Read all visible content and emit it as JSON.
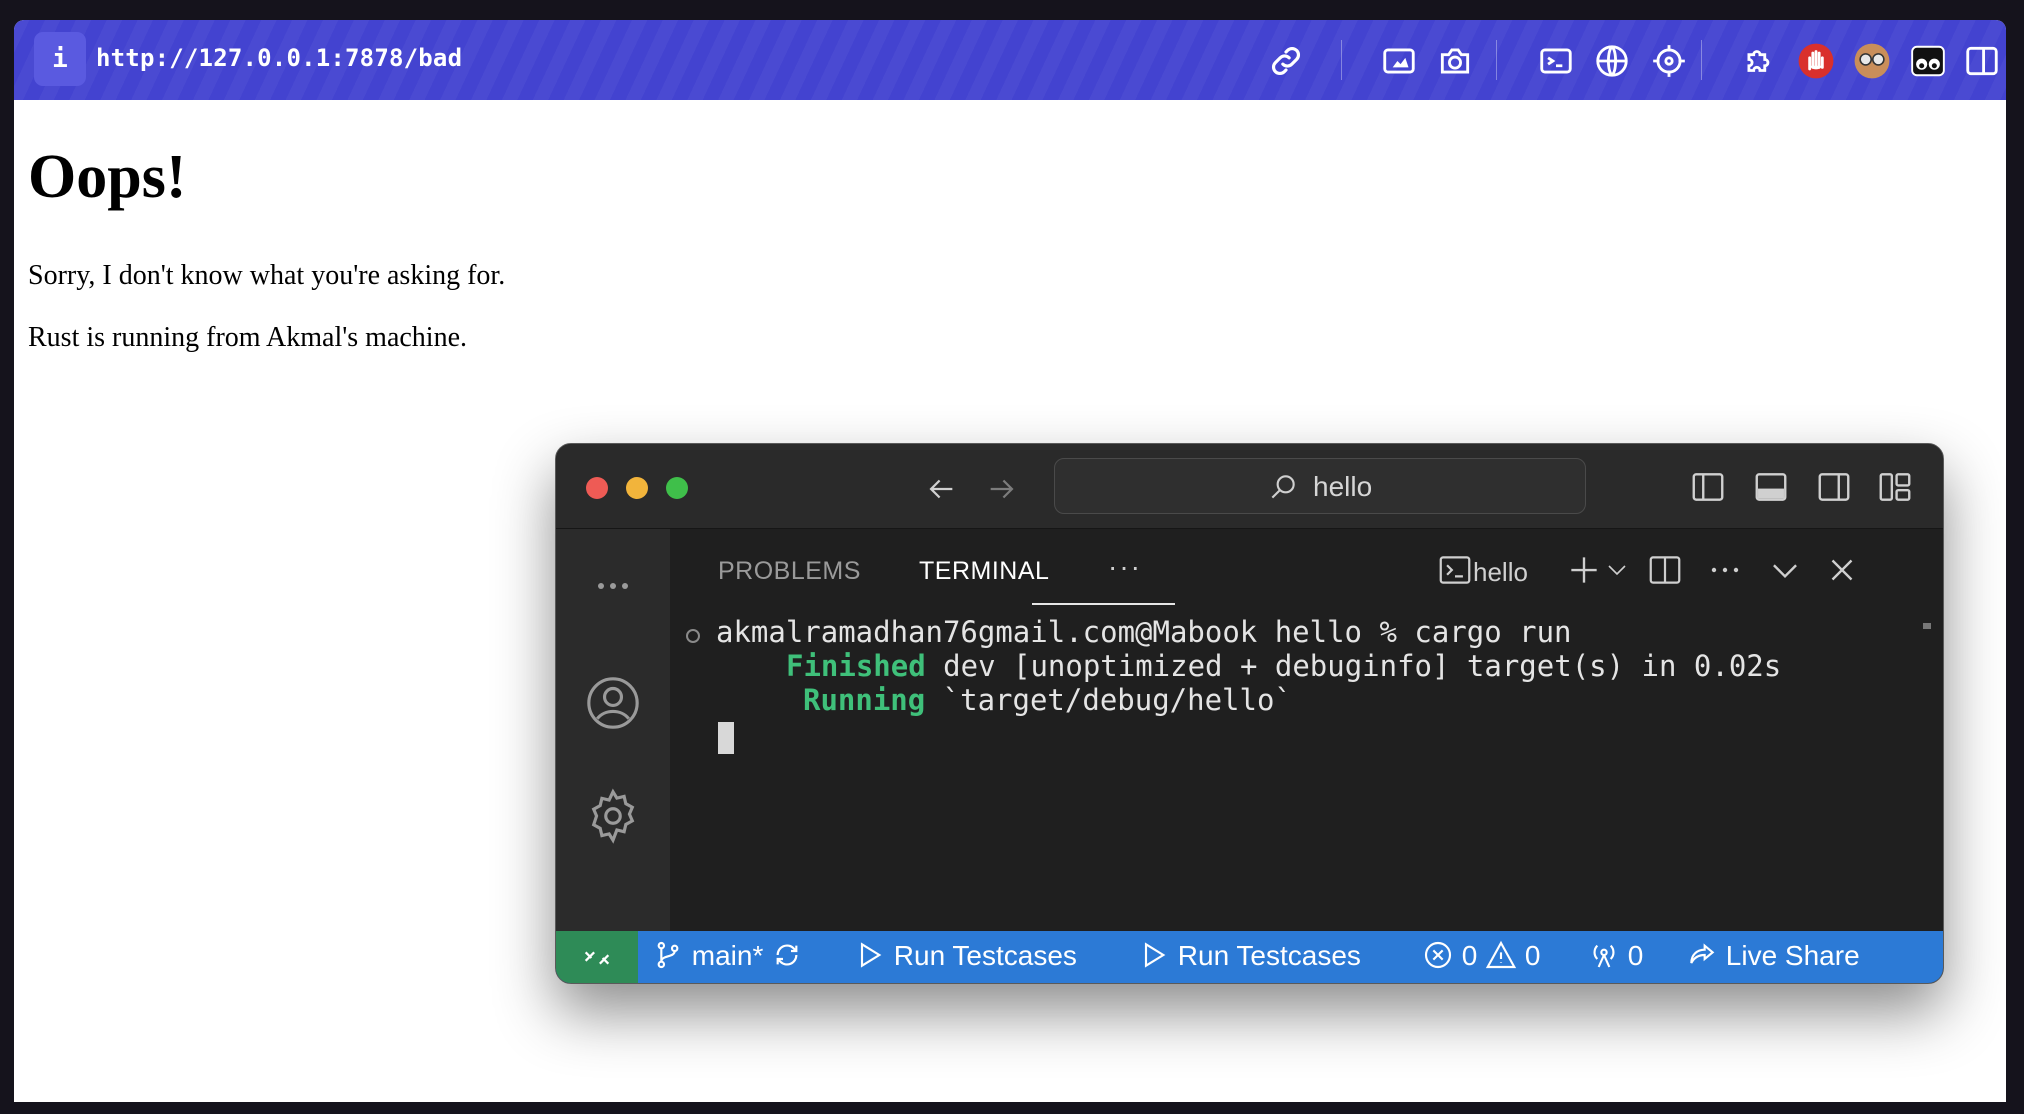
{
  "browser": {
    "url": "http://127.0.0.1:7878/bad",
    "info_glyph": "i",
    "toolbar_icons": [
      "link-icon",
      "image-icon",
      "camera-icon",
      "terminal-icon",
      "globe-icon",
      "crosshair-icon",
      "extension-icon",
      "hand-stop-icon",
      "glasses-avatar-icon",
      "eyes-icon",
      "sidebar-icon"
    ]
  },
  "page": {
    "heading": "Oops!",
    "line1": "Sorry, I don't know what you're asking for.",
    "line2": "Rust is running from Akmal's machine."
  },
  "vscode": {
    "search_text": "hello",
    "tabs": {
      "problems": "PROBLEMS",
      "terminal": "TERMINAL",
      "more": "···"
    },
    "terminal_name": "hello",
    "terminal_lines": {
      "prompt": "akmalramadhan76gmail.com@Mabook hello % cargo run",
      "finished_kw": "Finished",
      "finished_rest": " dev [unoptimized + debuginfo] target(s) in 0.02s",
      "running_kw": "Running",
      "running_rest": " `target/debug/hello`"
    },
    "status": {
      "branch": "main*",
      "run1": "Run Testcases",
      "run2": "Run Testcases",
      "errors": "0",
      "warnings": "0",
      "ports": "0",
      "live_share": "Live Share"
    },
    "colors": {
      "status_bar": "#2c7ad6",
      "remote": "#2e8b57",
      "terminal_ok": "#3fc07a",
      "url_bar": "#4343d0"
    }
  }
}
